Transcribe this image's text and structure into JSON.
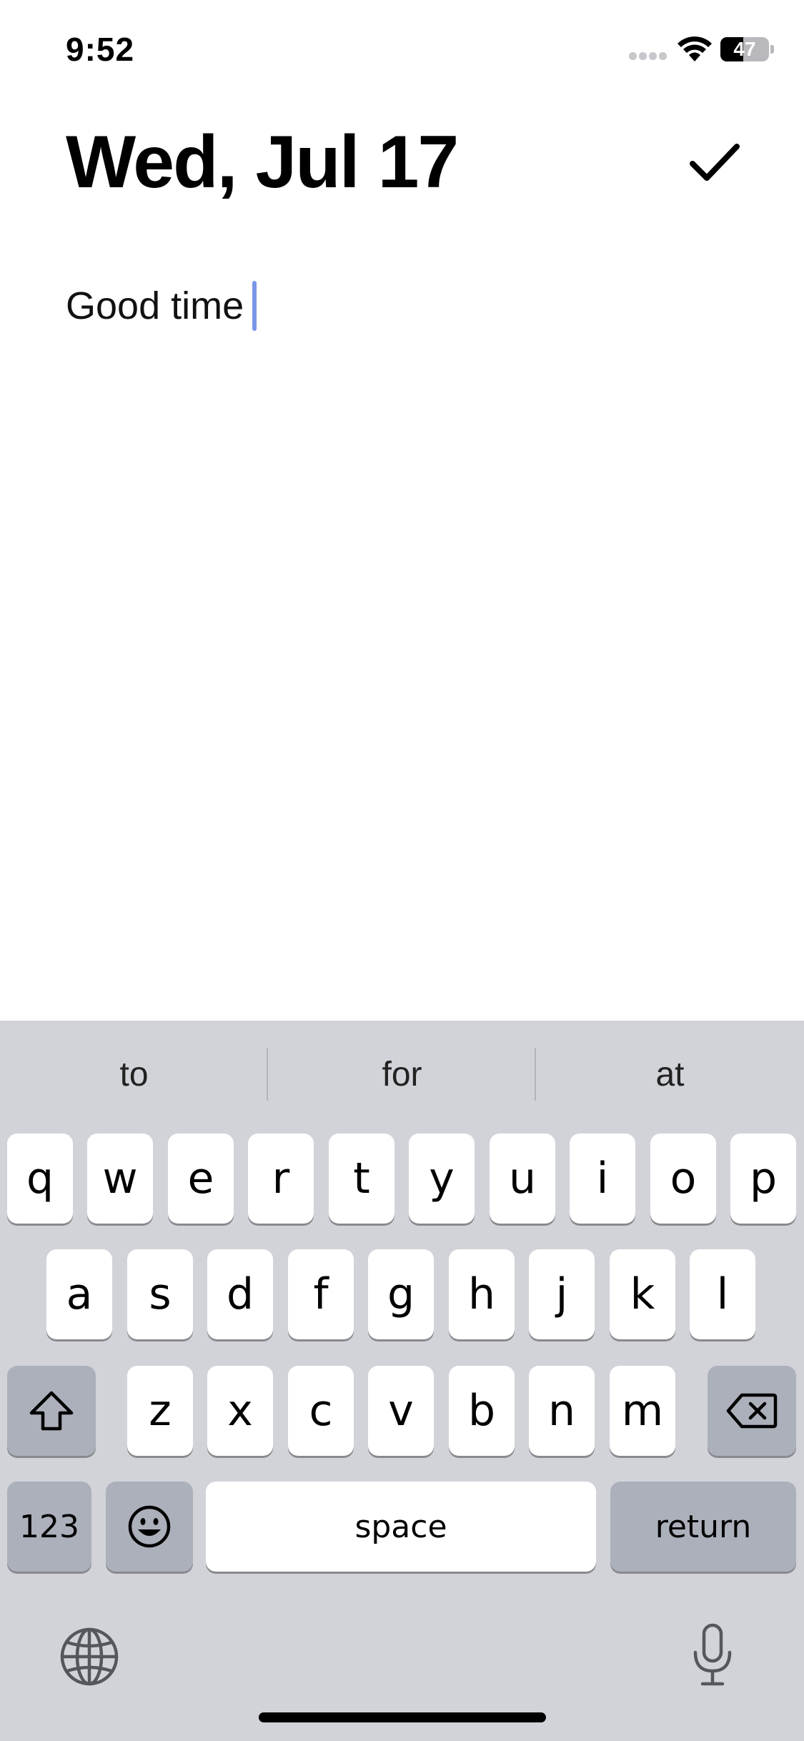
{
  "status_bar": {
    "time": "9:52",
    "battery_percent": "47"
  },
  "header": {
    "title": "Wed, Jul 17"
  },
  "editor": {
    "text": "Good time"
  },
  "keyboard": {
    "suggestions": [
      "to",
      "for",
      "at"
    ],
    "row1": [
      "q",
      "w",
      "e",
      "r",
      "t",
      "y",
      "u",
      "i",
      "o",
      "p"
    ],
    "row2": [
      "a",
      "s",
      "d",
      "f",
      "g",
      "h",
      "j",
      "k",
      "l"
    ],
    "row3": [
      "z",
      "x",
      "c",
      "v",
      "b",
      "n",
      "m"
    ],
    "numbers_label": "123",
    "space_label": "space",
    "return_label": "return"
  },
  "colors": {
    "caret": "#7b95e8",
    "keyboard_bg": "#d1d3d9",
    "key_dark": "#abb0ba"
  }
}
